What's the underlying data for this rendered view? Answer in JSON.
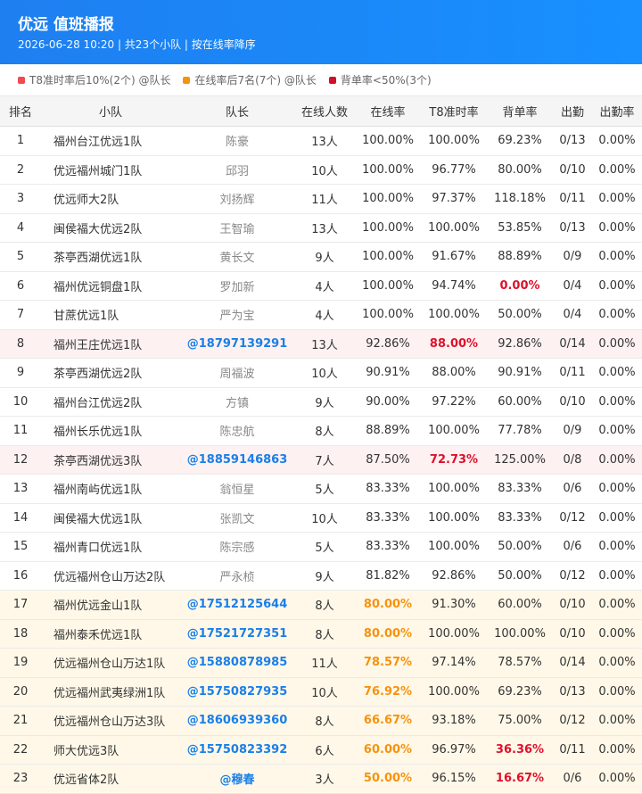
{
  "header": {
    "title": "优远 值班播报",
    "subtitle": "2026-06-28 10:20 | 共23个小队 | 按在线率降序"
  },
  "legend": [
    {
      "label": "T8准时率后10%(2个) @队长",
      "color": "#f04a52"
    },
    {
      "label": "在线率后7名(7个) @队长",
      "color": "#f5930f"
    },
    {
      "label": "背单率<50%(3个)",
      "color": "#d0112b"
    }
  ],
  "columns": [
    "排名",
    "小队",
    "队长",
    "在线人数",
    "在线率",
    "T8准时率",
    "背单率",
    "出勤",
    "出勤率"
  ],
  "rows": [
    {
      "rank": "1",
      "team": "福州台江优远1队",
      "leader": "陈豪",
      "online": "13人",
      "online_rate": "100.00%",
      "t8": "100.00%",
      "back": "69.23%",
      "attend": "0/13",
      "attend_rate": "0.00%"
    },
    {
      "rank": "2",
      "team": "优远福州城门1队",
      "leader": "邱羽",
      "online": "10人",
      "online_rate": "100.00%",
      "t8": "96.77%",
      "back": "80.00%",
      "attend": "0/10",
      "attend_rate": "0.00%"
    },
    {
      "rank": "3",
      "team": "优远师大2队",
      "leader": "刘扬辉",
      "online": "11人",
      "online_rate": "100.00%",
      "t8": "97.37%",
      "back": "118.18%",
      "attend": "0/11",
      "attend_rate": "0.00%"
    },
    {
      "rank": "4",
      "team": "闽侯福大优远2队",
      "leader": "王智瑜",
      "online": "13人",
      "online_rate": "100.00%",
      "t8": "100.00%",
      "back": "53.85%",
      "attend": "0/13",
      "attend_rate": "0.00%"
    },
    {
      "rank": "5",
      "team": "茶亭西湖优远1队",
      "leader": "黄长文",
      "online": "9人",
      "online_rate": "100.00%",
      "t8": "91.67%",
      "back": "88.89%",
      "attend": "0/9",
      "attend_rate": "0.00%"
    },
    {
      "rank": "6",
      "team": "福州优远铜盘1队",
      "leader": "罗加新",
      "online": "4人",
      "online_rate": "100.00%",
      "t8": "94.74%",
      "back": "0.00%",
      "attend": "0/4",
      "attend_rate": "0.00%",
      "back_hl": "red"
    },
    {
      "rank": "7",
      "team": "甘蔗优远1队",
      "leader": "严为宝",
      "online": "4人",
      "online_rate": "100.00%",
      "t8": "100.00%",
      "back": "50.00%",
      "attend": "0/4",
      "attend_rate": "0.00%"
    },
    {
      "rank": "8",
      "team": "福州王庄优远1队",
      "leader": "@18797139291",
      "online": "13人",
      "online_rate": "92.86%",
      "t8": "88.00%",
      "back": "92.86%",
      "attend": "0/14",
      "attend_rate": "0.00%",
      "row_hl": "red",
      "t8_hl": "red",
      "at": true
    },
    {
      "rank": "9",
      "team": "茶亭西湖优远2队",
      "leader": "周福波",
      "online": "10人",
      "online_rate": "90.91%",
      "t8": "88.00%",
      "back": "90.91%",
      "attend": "0/11",
      "attend_rate": "0.00%"
    },
    {
      "rank": "10",
      "team": "福州台江优远2队",
      "leader": "方镇",
      "online": "9人",
      "online_rate": "90.00%",
      "t8": "97.22%",
      "back": "60.00%",
      "attend": "0/10",
      "attend_rate": "0.00%"
    },
    {
      "rank": "11",
      "team": "福州长乐优远1队",
      "leader": "陈忠航",
      "online": "8人",
      "online_rate": "88.89%",
      "t8": "100.00%",
      "back": "77.78%",
      "attend": "0/9",
      "attend_rate": "0.00%"
    },
    {
      "rank": "12",
      "team": "茶亭西湖优远3队",
      "leader": "@18859146863",
      "online": "7人",
      "online_rate": "87.50%",
      "t8": "72.73%",
      "back": "125.00%",
      "attend": "0/8",
      "attend_rate": "0.00%",
      "row_hl": "red",
      "t8_hl": "red",
      "at": true
    },
    {
      "rank": "13",
      "team": "福州南屿优远1队",
      "leader": "翁恒星",
      "online": "5人",
      "online_rate": "83.33%",
      "t8": "100.00%",
      "back": "83.33%",
      "attend": "0/6",
      "attend_rate": "0.00%"
    },
    {
      "rank": "14",
      "team": "闽侯福大优远1队",
      "leader": "张凯文",
      "online": "10人",
      "online_rate": "83.33%",
      "t8": "100.00%",
      "back": "83.33%",
      "attend": "0/12",
      "attend_rate": "0.00%"
    },
    {
      "rank": "15",
      "team": "福州青口优远1队",
      "leader": "陈宗感",
      "online": "5人",
      "online_rate": "83.33%",
      "t8": "100.00%",
      "back": "50.00%",
      "attend": "0/6",
      "attend_rate": "0.00%"
    },
    {
      "rank": "16",
      "team": "优远福州仓山万达2队",
      "leader": "严永桢",
      "online": "9人",
      "online_rate": "81.82%",
      "t8": "92.86%",
      "back": "50.00%",
      "attend": "0/12",
      "attend_rate": "0.00%"
    },
    {
      "rank": "17",
      "team": "福州优远金山1队",
      "leader": "@17512125644",
      "online": "8人",
      "online_rate": "80.00%",
      "t8": "91.30%",
      "back": "60.00%",
      "attend": "0/10",
      "attend_rate": "0.00%",
      "row_hl": "yellow",
      "online_hl": "orange",
      "at": true
    },
    {
      "rank": "18",
      "team": "福州泰禾优远1队",
      "leader": "@17521727351",
      "online": "8人",
      "online_rate": "80.00%",
      "t8": "100.00%",
      "back": "100.00%",
      "attend": "0/10",
      "attend_rate": "0.00%",
      "row_hl": "yellow",
      "online_hl": "orange",
      "at": true
    },
    {
      "rank": "19",
      "team": "优远福州仓山万达1队",
      "leader": "@15880878985",
      "online": "11人",
      "online_rate": "78.57%",
      "t8": "97.14%",
      "back": "78.57%",
      "attend": "0/14",
      "attend_rate": "0.00%",
      "row_hl": "yellow",
      "online_hl": "orange",
      "at": true
    },
    {
      "rank": "20",
      "team": "优远福州武夷绿洲1队",
      "leader": "@15750827935",
      "online": "10人",
      "online_rate": "76.92%",
      "t8": "100.00%",
      "back": "69.23%",
      "attend": "0/13",
      "attend_rate": "0.00%",
      "row_hl": "yellow",
      "online_hl": "orange",
      "at": true
    },
    {
      "rank": "21",
      "team": "优远福州仓山万达3队",
      "leader": "@18606939360",
      "online": "8人",
      "online_rate": "66.67%",
      "t8": "93.18%",
      "back": "75.00%",
      "attend": "0/12",
      "attend_rate": "0.00%",
      "row_hl": "yellow",
      "online_hl": "orange",
      "at": true
    },
    {
      "rank": "22",
      "team": "师大优远3队",
      "leader": "@15750823392",
      "online": "6人",
      "online_rate": "60.00%",
      "t8": "96.97%",
      "back": "36.36%",
      "attend": "0/11",
      "attend_rate": "0.00%",
      "row_hl": "yellow",
      "online_hl": "orange",
      "back_hl": "red",
      "at": true
    },
    {
      "rank": "23",
      "team": "优远省体2队",
      "leader": "@穆春",
      "online": "3人",
      "online_rate": "50.00%",
      "t8": "96.15%",
      "back": "16.67%",
      "attend": "0/6",
      "attend_rate": "0.00%",
      "row_hl": "yellow",
      "online_hl": "orange",
      "back_hl": "red",
      "at": true
    }
  ]
}
